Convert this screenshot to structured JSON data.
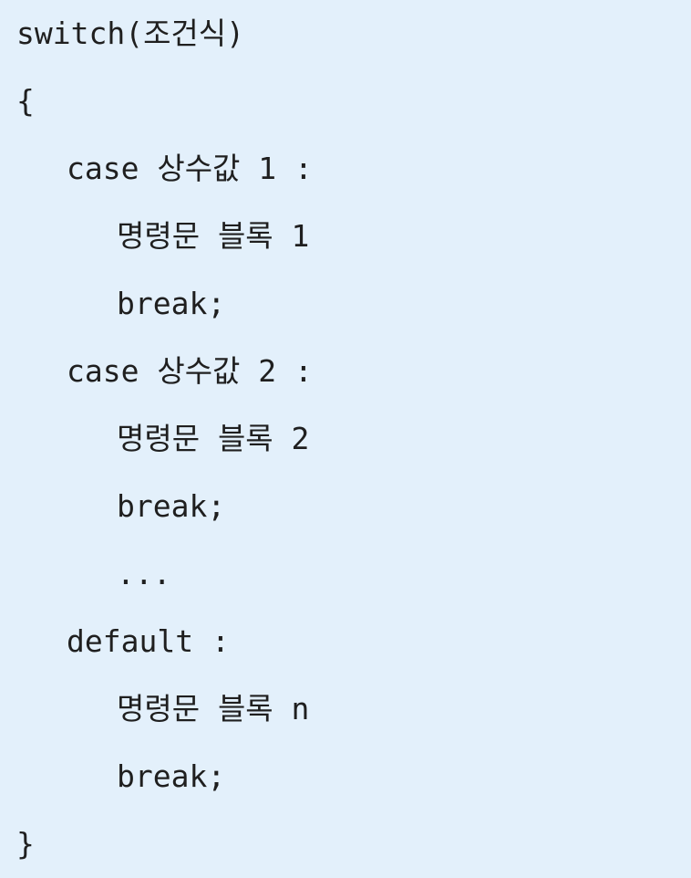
{
  "code": {
    "lines": [
      {
        "text": "switch(조건식)"
      },
      {
        "text": "{"
      },
      {
        "text": "case 상수값 1 :"
      },
      {
        "text": "명령문 블록 1"
      },
      {
        "text": "break;"
      },
      {
        "text": "case 상수값 2 :"
      },
      {
        "text": "명령문 블록 2"
      },
      {
        "text": "break;"
      },
      {
        "text": "..."
      },
      {
        "text": "default :"
      },
      {
        "text": "명령문 블록 n"
      },
      {
        "text": "break;"
      },
      {
        "text": "}"
      }
    ]
  }
}
